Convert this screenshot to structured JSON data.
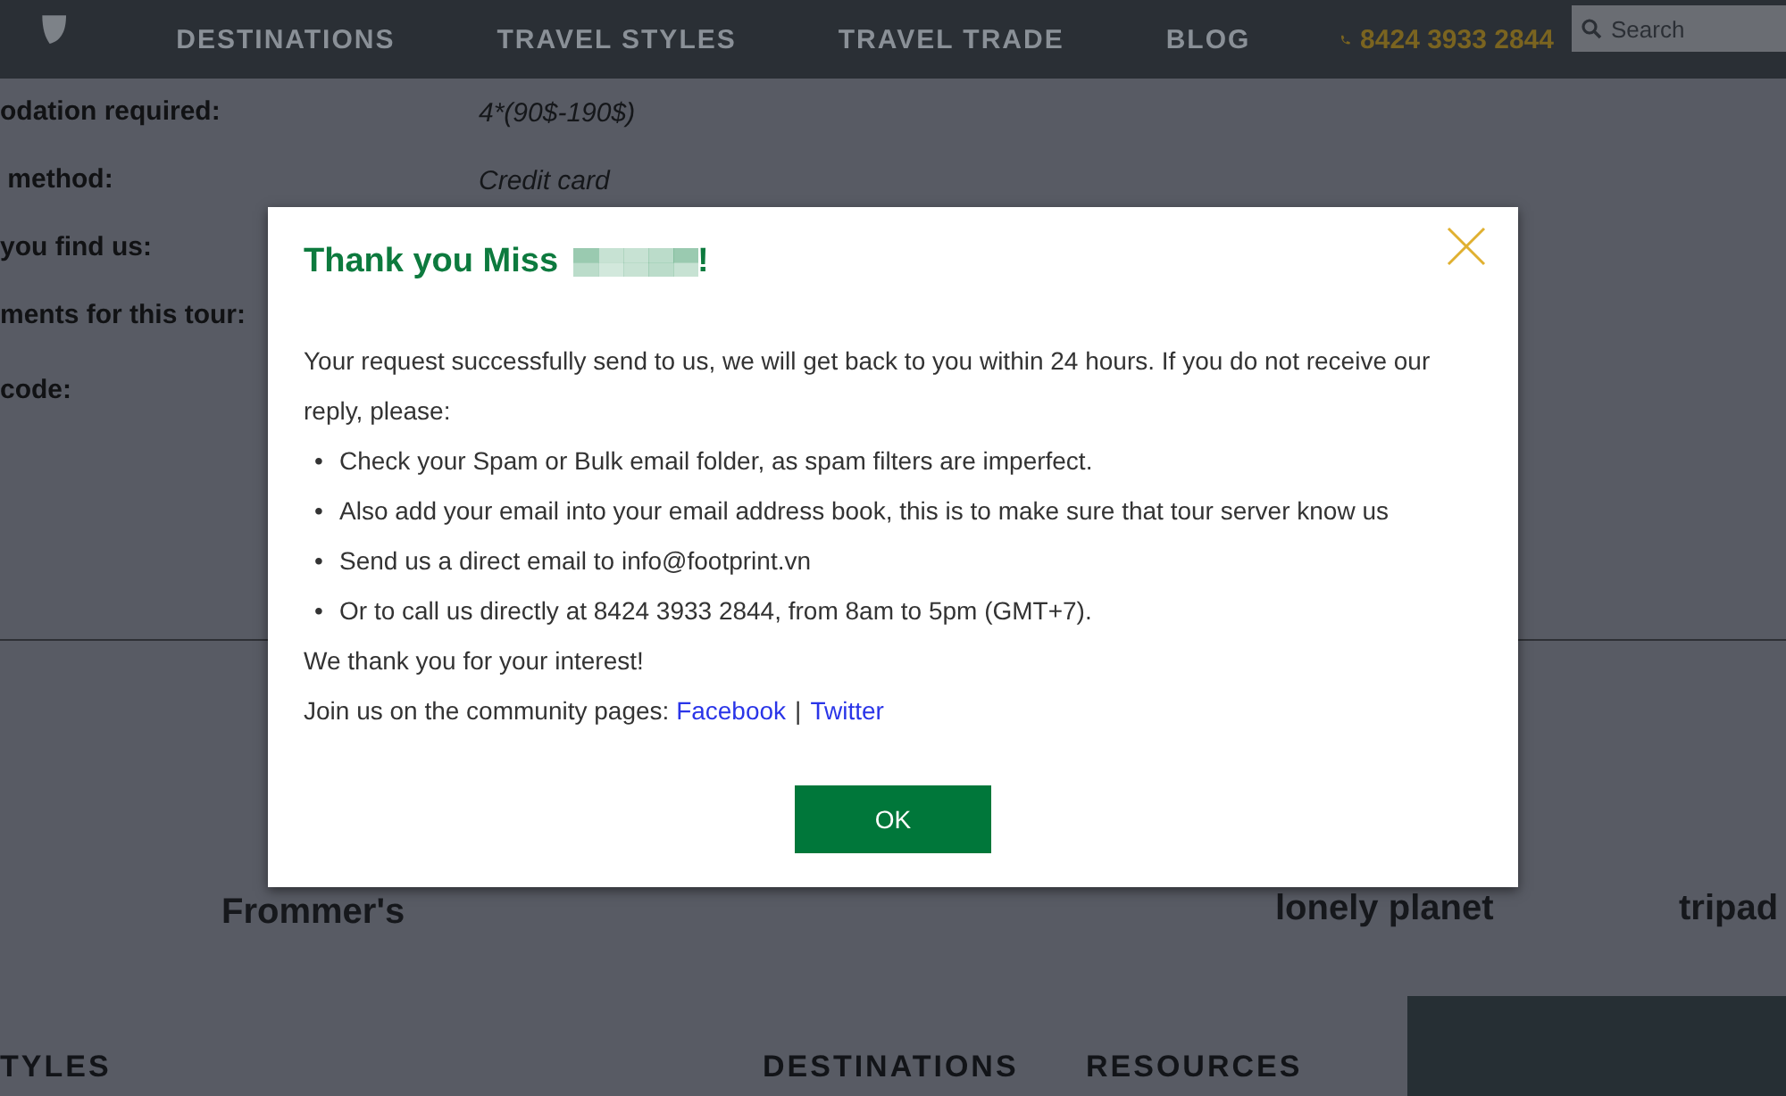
{
  "header": {
    "nav": [
      "DESTINATIONS",
      "TRAVEL STYLES",
      "TRAVEL TRADE",
      "BLOG"
    ],
    "phone": "8424 3933 2844",
    "search": {
      "placeholder": "Search"
    }
  },
  "form_rows": [
    {
      "label": "odation required:",
      "value": "4*(90$-190$)"
    },
    {
      "label": " method:",
      "value": "Credit card"
    },
    {
      "label": "you find us:"
    },
    {
      "label": "ments for this tour:"
    },
    {
      "label": "code:"
    }
  ],
  "partners": [
    "Frommer's",
    "lonely planet",
    "tripad"
  ],
  "footer": {
    "headings": [
      "TYLES",
      "DESTINATIONS",
      "RESOURCES"
    ]
  },
  "dialog": {
    "title_prefix": "Thank you Miss",
    "title_suffix": "!",
    "intro": "Your request successfully send to us, we will get back to you within 24 hours. If you do not receive our reply, please:",
    "bullet": "•",
    "bullets": [
      "Check your Spam or Bulk email folder, as spam filters are imperfect.",
      "Also add your email into your email address book, this is to make sure that tour server know us",
      "Send us a direct email to info@footprint.vn",
      "Or to call us directly at 8424 3933 2844, from 8am to 5pm (GMT+7)."
    ],
    "thanks": "We thank you for your interest!",
    "community_prefix": "Join us on the community pages:",
    "links": [
      "Facebook",
      "Twitter"
    ],
    "separator": "|",
    "ok": "OK"
  }
}
